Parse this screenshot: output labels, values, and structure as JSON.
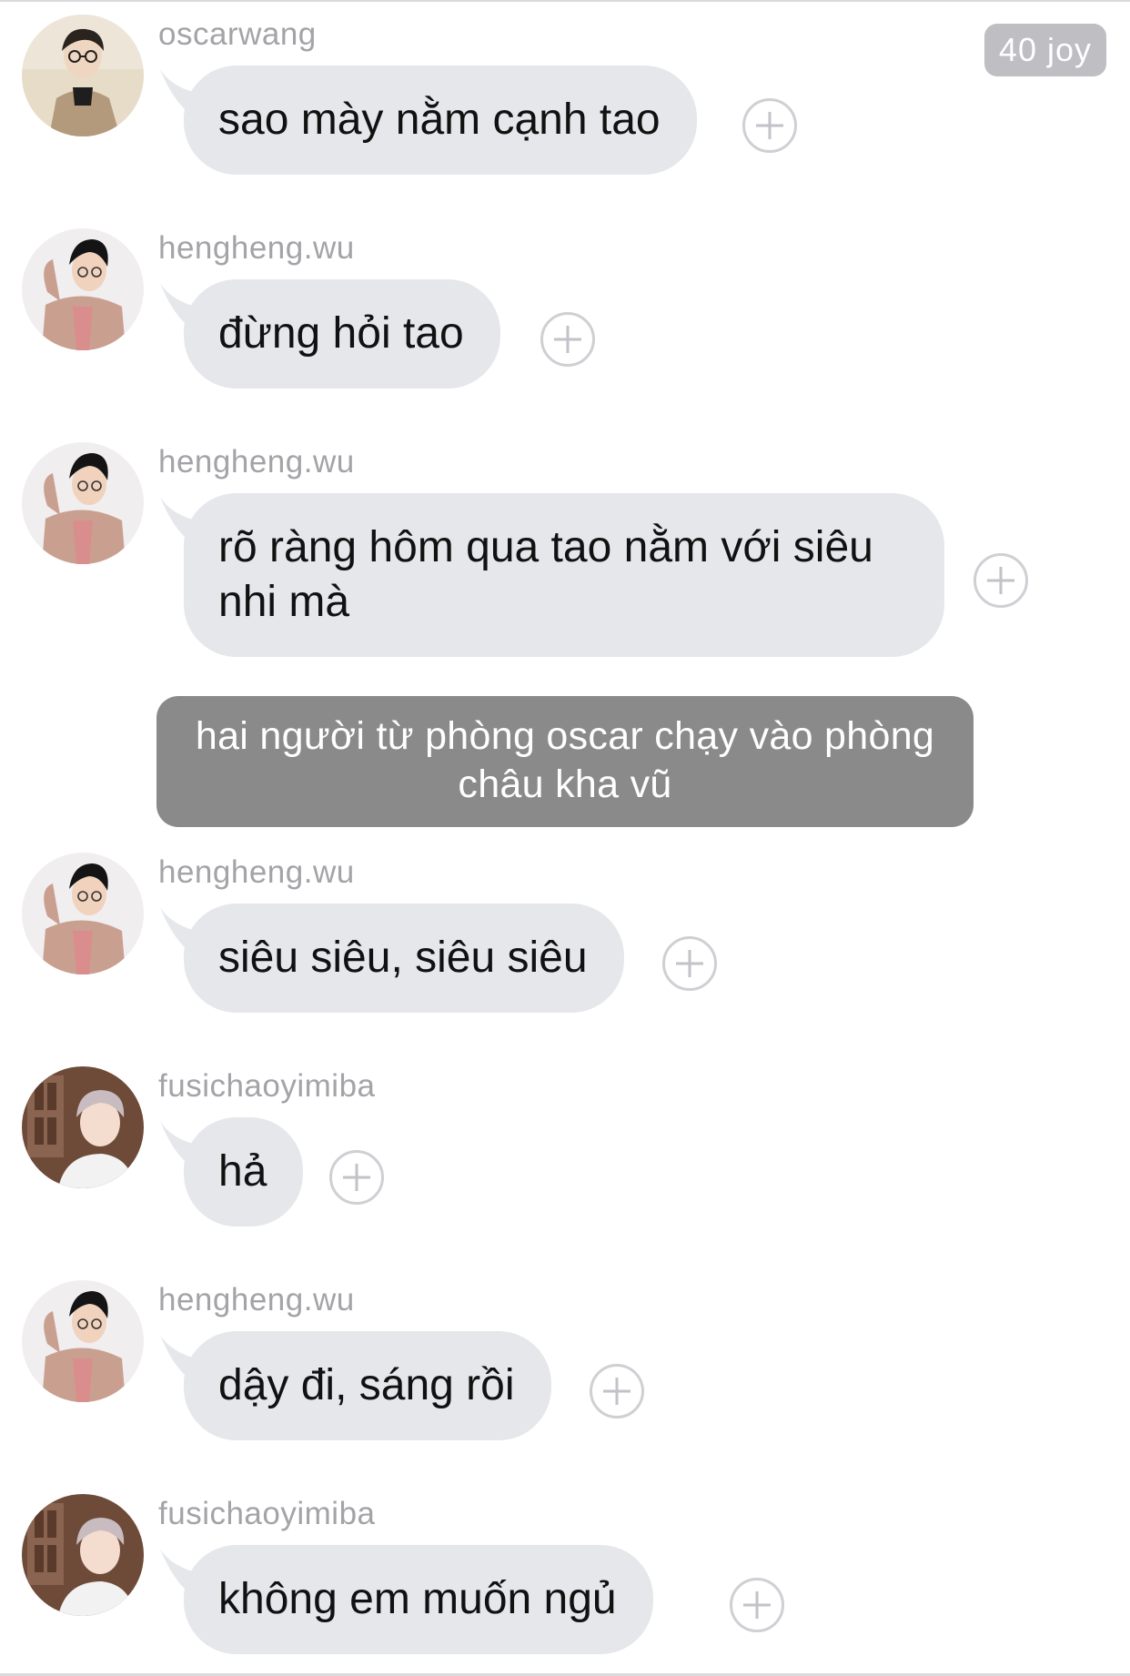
{
  "header": {
    "badge_label": "40 joy"
  },
  "messages": [
    {
      "username": "oscarwang",
      "text": "sao mày nằm cạnh tao",
      "avatar": "oscarwang-avatar"
    },
    {
      "username": "hengheng.wu",
      "text": "đừng hỏi tao",
      "avatar": "hengheng-avatar"
    },
    {
      "username": "hengheng.wu",
      "text": "rõ ràng hôm qua tao nằm với siêu nhi mà",
      "avatar": "hengheng-avatar"
    },
    {
      "username": "hengheng.wu",
      "text": "siêu siêu, siêu siêu",
      "avatar": "hengheng-avatar"
    },
    {
      "username": "fusichaoyimiba",
      "text": "hả",
      "avatar": "fusichao-avatar"
    },
    {
      "username": "hengheng.wu",
      "text": "dậy đi, sáng rồi",
      "avatar": "hengheng-avatar"
    },
    {
      "username": "fusichaoyimiba",
      "text": "không em muốn ngủ",
      "avatar": "fusichao-avatar"
    }
  ],
  "narration": {
    "text": "hai người từ phòng oscar chạy vào phòng châu kha vũ"
  },
  "colors": {
    "bubble": "#e5e7eb",
    "narration": "#8a8a8a",
    "username": "#a3a3a8",
    "badge": "#bebec3"
  },
  "icons": {
    "add_reaction": "plus-circle-icon"
  }
}
